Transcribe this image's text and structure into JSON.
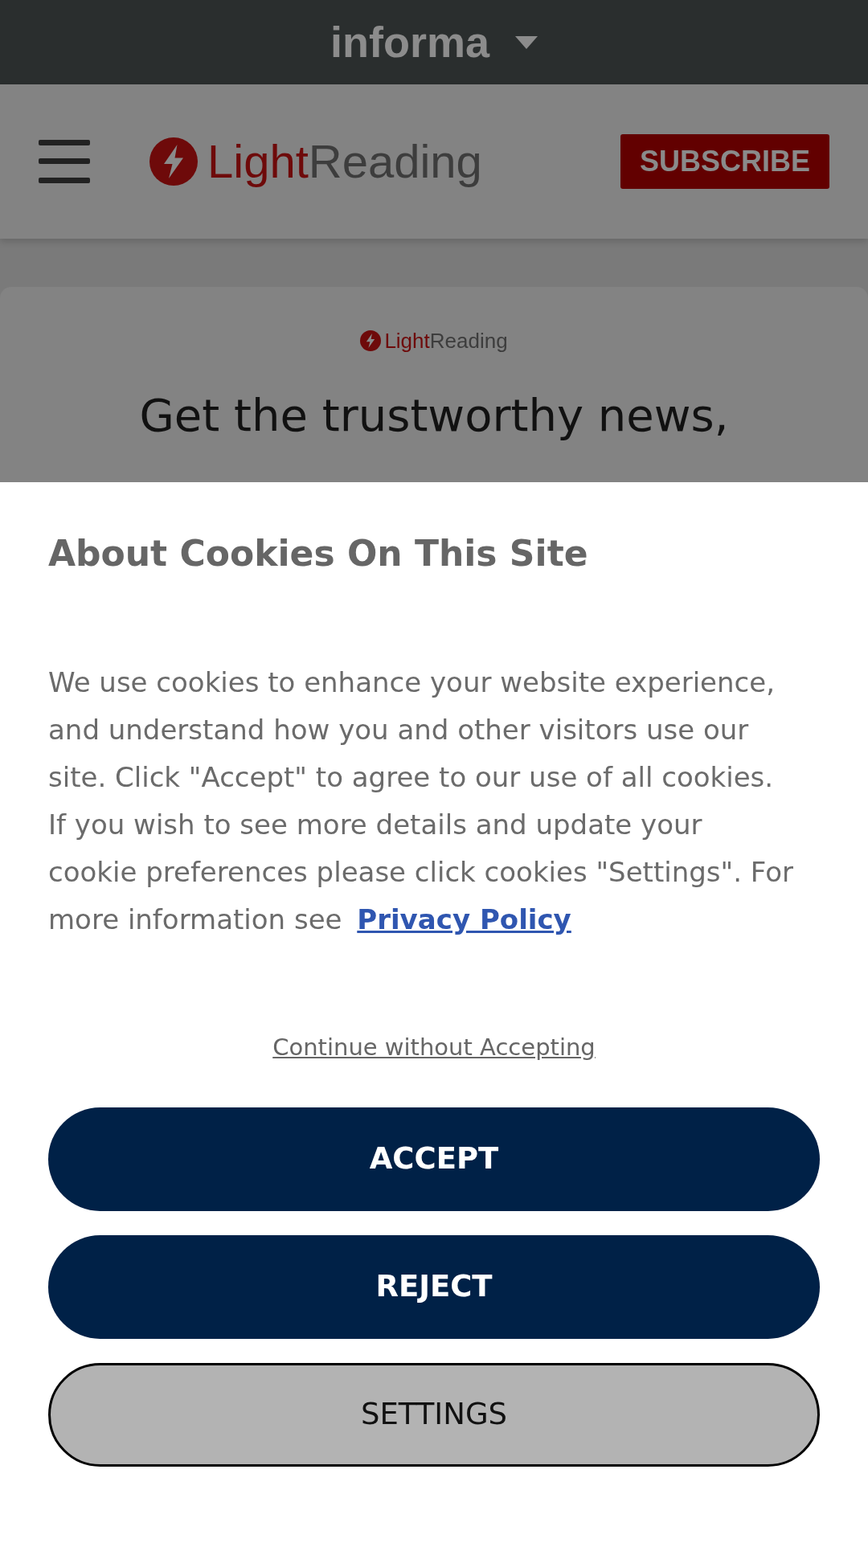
{
  "top_bar": {
    "brand": "informa"
  },
  "header": {
    "logo": [
      "Light",
      "Reading"
    ],
    "subscribe": "SUBSCRIBE"
  },
  "card": {
    "logo": [
      "Light",
      "Reading"
    ],
    "headline": "Get the trustworthy news,"
  },
  "cookie_dialog": {
    "title": "About Cookies On This Site",
    "body": "We use cookies to enhance your website experience, and understand how you and other visitors use our site. Click \"Accept\" to agree to our use of all cookies. If you wish to see more details and update your cookie preferences please click cookies \"Settings\". For more information see",
    "link": "Privacy Policy",
    "continue": "Continue without Accepting",
    "buttons": [
      {
        "label": "ACCEPT",
        "kind": "primary"
      },
      {
        "label": "REJECT",
        "kind": "primary"
      },
      {
        "label": "SETTINGS",
        "kind": "secondary"
      }
    ]
  }
}
